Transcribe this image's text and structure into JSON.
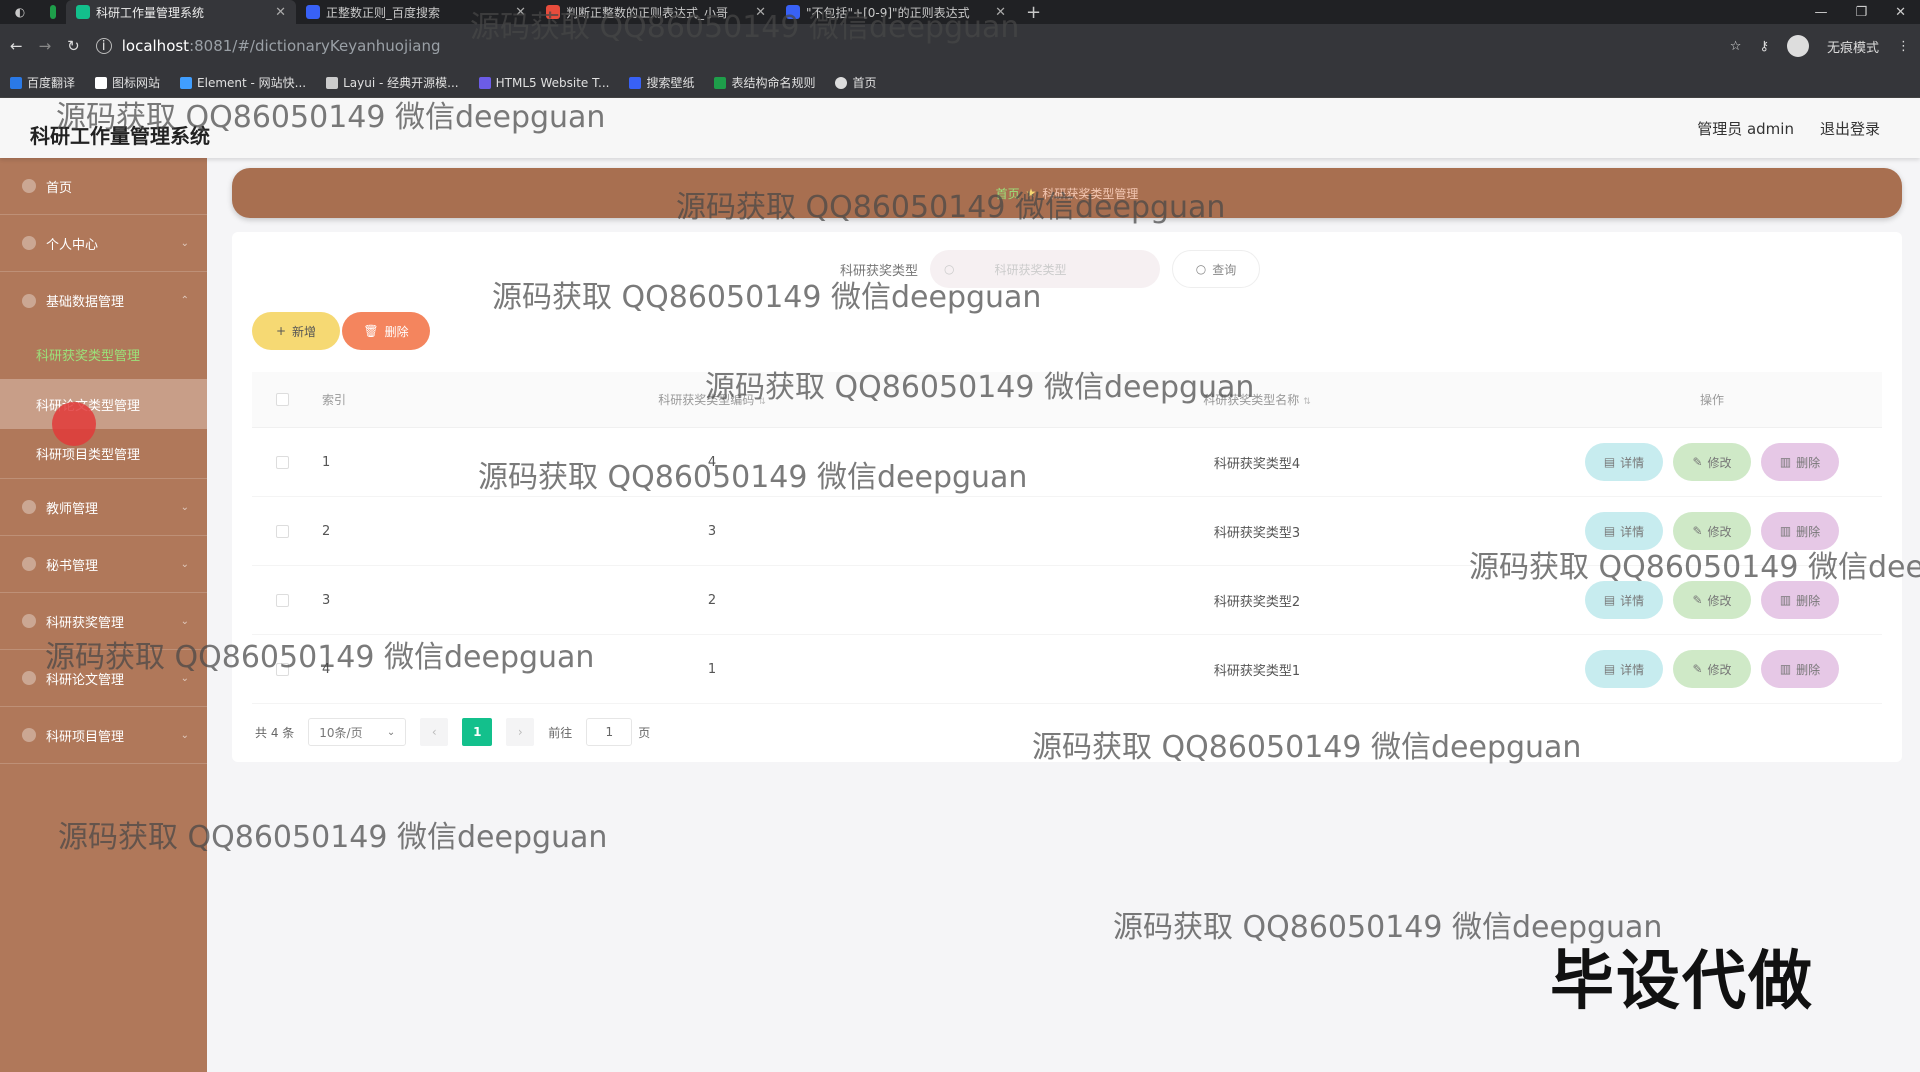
{
  "browser": {
    "tabs": [
      {
        "title": "科研工作量管理系统",
        "active": true,
        "color": "#13c08c"
      },
      {
        "title": "正整数正则_百度搜索",
        "active": false,
        "color": "#3861f6"
      },
      {
        "title": "判断正整数的正则表达式_小哥",
        "active": false,
        "color": "#e74c3c"
      },
      {
        "title": "\"不包括\"+[0-9]\"的正则表达式",
        "active": false,
        "color": "#3861f6"
      }
    ],
    "url_host": "localhost",
    "url_path": ":8081/#/dictionaryKeyanhuojiang",
    "incognito_label": "无痕模式",
    "bookmarks": [
      "百度翻译",
      "图标网站",
      "Element - 网站快...",
      "Layui - 经典开源模...",
      "HTML5 Website T...",
      "搜索壁纸",
      "表结构命名规则",
      "首页"
    ]
  },
  "header": {
    "title": "科研工作量管理系统",
    "user": "管理员 admin",
    "logout": "退出登录"
  },
  "sidebar": {
    "items": [
      {
        "label": "首页"
      },
      {
        "label": "个人中心"
      },
      {
        "label": "基础数据管理"
      },
      {
        "label": "教师管理"
      },
      {
        "label": "秘书管理"
      },
      {
        "label": "科研获奖管理"
      },
      {
        "label": "科研论文管理"
      },
      {
        "label": "科研项目管理"
      }
    ],
    "sub_items": [
      "科研获奖类型管理",
      "科研论文类型管理",
      "科研项目类型管理"
    ]
  },
  "breadcrumb": {
    "home": "首页",
    "current": "科研获奖类型管理"
  },
  "search": {
    "label": "科研获奖类型",
    "placeholder": "科研获奖类型",
    "button": "查询"
  },
  "actions": {
    "add": "新增",
    "delete": "删除"
  },
  "table": {
    "headers": {
      "index": "索引",
      "code": "科研获奖类型编码",
      "name": "科研获奖类型名称",
      "ops": "操作"
    },
    "rows": [
      {
        "index": "1",
        "code": "4",
        "name": "科研获奖类型4"
      },
      {
        "index": "2",
        "code": "3",
        "name": "科研获奖类型3"
      },
      {
        "index": "3",
        "code": "2",
        "name": "科研获奖类型2"
      },
      {
        "index": "4",
        "code": "1",
        "name": "科研获奖类型1"
      }
    ],
    "op_labels": {
      "detail": "详情",
      "edit": "修改",
      "delete": "删除"
    }
  },
  "pagination": {
    "total": "共 4 条",
    "page_size": "10条/页",
    "current_page": "1",
    "goto_label": "前往",
    "goto_value": "1",
    "page_suffix": "页"
  },
  "watermark": {
    "text": "源码获取 QQ86050149 微信deepguan",
    "stamp": "毕设代做"
  }
}
